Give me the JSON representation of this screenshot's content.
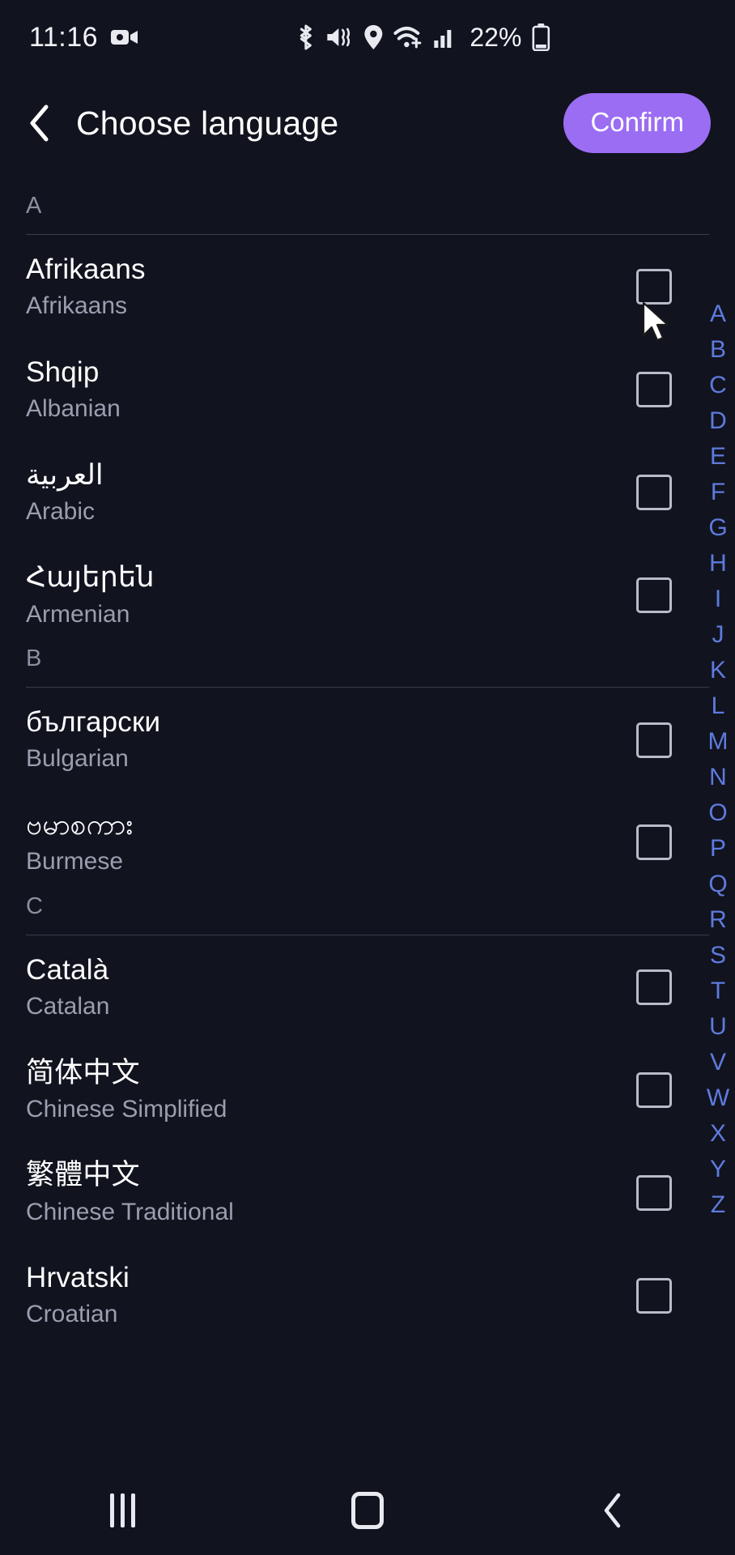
{
  "statusbar": {
    "time": "11:16",
    "icons_left": [
      "video-camera-icon"
    ],
    "icons_right": [
      "bluetooth-icon",
      "mute-vibrate-icon",
      "location-icon",
      "wifi-icon",
      "cellular-signal-icon"
    ],
    "battery_percent": "22%",
    "battery_level": 22
  },
  "header": {
    "back_label": "back",
    "title": "Choose language",
    "confirm_label": "Confirm",
    "confirm_color": "#9b6df2"
  },
  "list": [
    {
      "type": "section",
      "letter": "A"
    },
    {
      "type": "language",
      "native": "Afrikaans",
      "english": "Afrikaans",
      "checked": false
    },
    {
      "type": "language",
      "native": "Shqip",
      "english": "Albanian",
      "checked": false
    },
    {
      "type": "language",
      "native": "العربية",
      "english": "Arabic",
      "checked": false
    },
    {
      "type": "language",
      "native": "Հայերեն",
      "english": "Armenian",
      "checked": false
    },
    {
      "type": "section",
      "letter": "B"
    },
    {
      "type": "language",
      "native": "български",
      "english": "Bulgarian",
      "checked": false
    },
    {
      "type": "language",
      "native": "ဗမာစကား",
      "english": "Burmese",
      "checked": false
    },
    {
      "type": "section",
      "letter": "C"
    },
    {
      "type": "language",
      "native": "Català",
      "english": "Catalan",
      "checked": false
    },
    {
      "type": "language",
      "native": "简体中文",
      "english": "Chinese Simplified",
      "checked": false
    },
    {
      "type": "language",
      "native": "繁體中文",
      "english": "Chinese Traditional",
      "checked": false
    },
    {
      "type": "language",
      "native": "Hrvatski",
      "english": "Croatian",
      "checked": false
    }
  ],
  "alpha_index": {
    "letters": [
      "A",
      "B",
      "C",
      "D",
      "E",
      "F",
      "G",
      "H",
      "I",
      "J",
      "K",
      "L",
      "M",
      "N",
      "O",
      "P",
      "Q",
      "R",
      "S",
      "T",
      "U",
      "V",
      "W",
      "X",
      "Y",
      "Z"
    ],
    "color": "#5e7bdd"
  },
  "navbar": {
    "recents_label": "recents",
    "home_label": "home",
    "back_label": "back"
  },
  "colors": {
    "background": "#11131f",
    "accent": "#9b6df2",
    "primary_text": "#ffffff",
    "secondary_text": "#9a9eae",
    "index_blue": "#5e7bdd"
  }
}
